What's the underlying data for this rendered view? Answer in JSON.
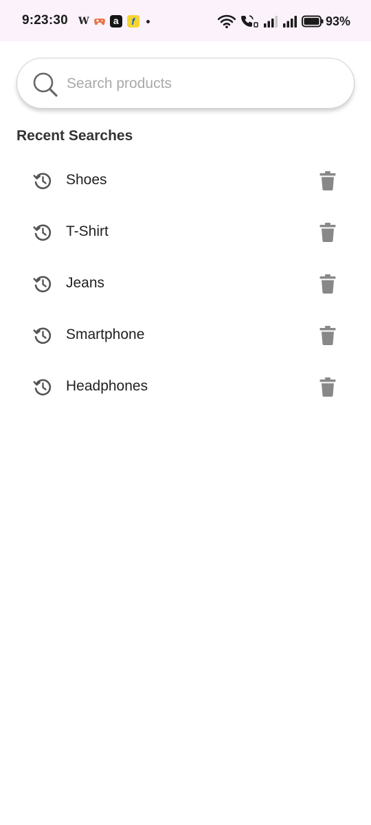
{
  "status_bar": {
    "time": "9:23:30",
    "notif_w": "W",
    "notif_a": "a",
    "notif_f": "f",
    "battery_percent": "93%"
  },
  "search": {
    "placeholder": "Search products",
    "value": ""
  },
  "recent": {
    "title": "Recent Searches",
    "items": [
      {
        "label": "Shoes"
      },
      {
        "label": "T-Shirt"
      },
      {
        "label": "Jeans"
      },
      {
        "label": "Smartphone"
      },
      {
        "label": "Headphones"
      }
    ]
  },
  "colors": {
    "status_bar_bg": "#fbf2fb",
    "icon_gray": "#888888",
    "history_icon": "#555555",
    "placeholder": "#a9a9a9"
  }
}
